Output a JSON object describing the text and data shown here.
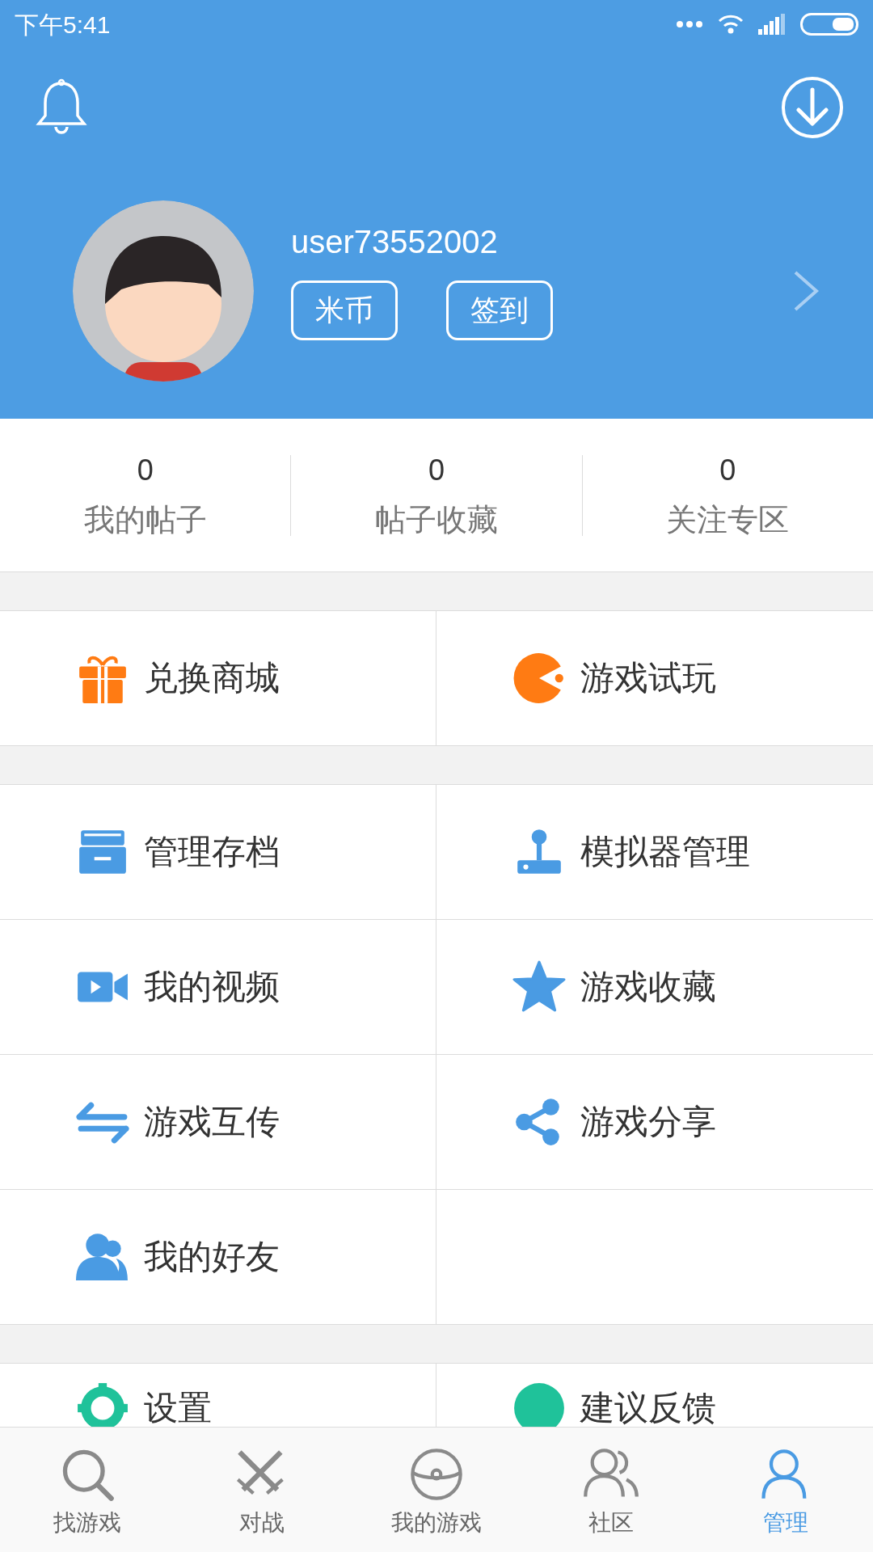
{
  "status_bar": {
    "time": "下午5:41"
  },
  "profile": {
    "username": "user73552002",
    "buttons": [
      "米币",
      "签到"
    ]
  },
  "stats": [
    {
      "count": "0",
      "label": "我的帖子"
    },
    {
      "count": "0",
      "label": "帖子收藏"
    },
    {
      "count": "0",
      "label": "关注专区"
    }
  ],
  "menu_groups": [
    {
      "items": [
        {
          "label": "兑换商城"
        },
        {
          "label": "游戏试玩"
        }
      ]
    },
    {
      "items": [
        {
          "label": "管理存档"
        },
        {
          "label": "模拟器管理"
        },
        {
          "label": "我的视频"
        },
        {
          "label": "游戏收藏"
        },
        {
          "label": "游戏互传"
        },
        {
          "label": "游戏分享"
        },
        {
          "label": "我的好友"
        }
      ]
    },
    {
      "items": [
        {
          "label": "设置"
        },
        {
          "label": "建议反馈"
        }
      ]
    }
  ],
  "bottom_nav": [
    {
      "label": "找游戏",
      "selected": false
    },
    {
      "label": "对战",
      "selected": false
    },
    {
      "label": "我的游戏",
      "selected": false
    },
    {
      "label": "社区",
      "selected": false
    },
    {
      "label": "管理",
      "selected": true
    }
  ]
}
